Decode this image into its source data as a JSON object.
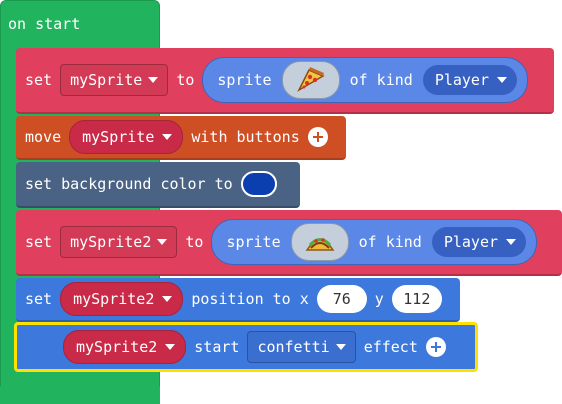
{
  "on_start": {
    "label": "on start"
  },
  "set1": {
    "keyword": "set",
    "variable": "mySprite",
    "to": "to",
    "sprite": "sprite",
    "image": "pizza-icon",
    "of_kind": "of kind",
    "kind": "Player"
  },
  "move": {
    "keyword": "move",
    "variable": "mySprite",
    "with_buttons": "with buttons"
  },
  "background": {
    "label": "set background color to",
    "color": "#0b3fb0"
  },
  "set2": {
    "keyword": "set",
    "variable": "mySprite2",
    "to": "to",
    "sprite": "sprite",
    "image": "taco-icon",
    "of_kind": "of kind",
    "kind": "Player"
  },
  "position": {
    "keyword": "set",
    "variable": "mySprite2",
    "position_to_x": "position to x",
    "x": "76",
    "y_label": "y",
    "y": "112"
  },
  "effect": {
    "variable": "mySprite2",
    "start": "start",
    "effect_name": "confetti",
    "effect": "effect"
  },
  "colors": {
    "events": "#22b35e",
    "variables": "#e0405e",
    "controller": "#cf4f25",
    "scene": "#4a6384",
    "sprites": "#3d78dc",
    "selected_outline": "#ffe100"
  }
}
